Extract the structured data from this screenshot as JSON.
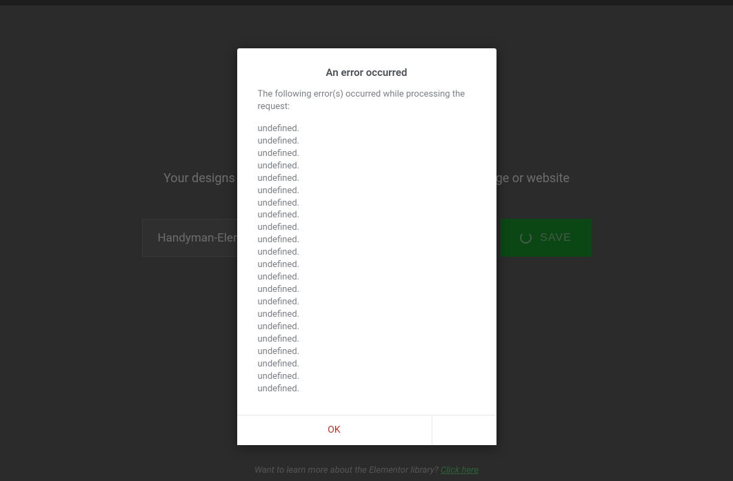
{
  "background": {
    "subtitle": "Your designs will be available for export and reuse on any page or website",
    "template_name_value": "Handyman-Elementor",
    "save_button_label": "SAVE",
    "footer_prompt": "Want to learn more about the Elementor library? ",
    "footer_link_text": "Click here"
  },
  "modal": {
    "title": "An error occurred",
    "intro": "The following error(s) occurred while processing the request:",
    "errors": [
      "undefined.",
      "undefined.",
      "undefined.",
      "undefined.",
      "undefined.",
      "undefined.",
      "undefined.",
      "undefined.",
      "undefined.",
      "undefined.",
      "undefined.",
      "undefined.",
      "undefined.",
      "undefined.",
      "undefined.",
      "undefined.",
      "undefined.",
      "undefined.",
      "undefined.",
      "undefined.",
      "undefined.",
      "undefined."
    ],
    "ok_label": "OK"
  }
}
